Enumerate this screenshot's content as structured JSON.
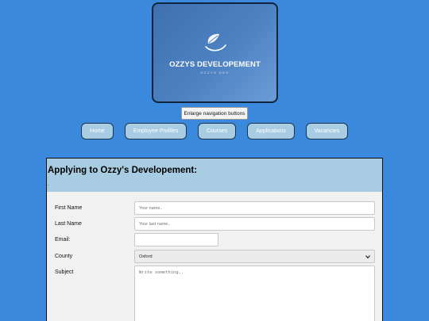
{
  "logo": {
    "title": "OZZYS DEVELOPEMENT",
    "subtitle": "OZZYS DEV",
    "icon": "leaf-icon",
    "background_color": "#4d82c2"
  },
  "enlarge_button": {
    "label": "Enlarge navigation buttons"
  },
  "nav": {
    "items": [
      {
        "label": "Home"
      },
      {
        "label": "Employee Profiles"
      },
      {
        "label": "Courses"
      },
      {
        "label": "Applications"
      },
      {
        "label": "Vacancies"
      }
    ],
    "button_color": "#a8cde3"
  },
  "form": {
    "title": "Applying to Ozzy's Developement:",
    "marker": ".",
    "first_name": {
      "label": "First Name",
      "placeholder": "Your name.."
    },
    "last_name": {
      "label": "Last Name",
      "placeholder": "Your last name.."
    },
    "email": {
      "label": "Email:",
      "placeholder": ""
    },
    "county": {
      "label": "County",
      "selected": "Oxford"
    },
    "subject": {
      "label": "Subject",
      "placeholder": "Write something.."
    }
  },
  "colors": {
    "page_background": "#3a89dc",
    "header_background": "#a8cde3",
    "form_background": "#f1f1f1"
  }
}
